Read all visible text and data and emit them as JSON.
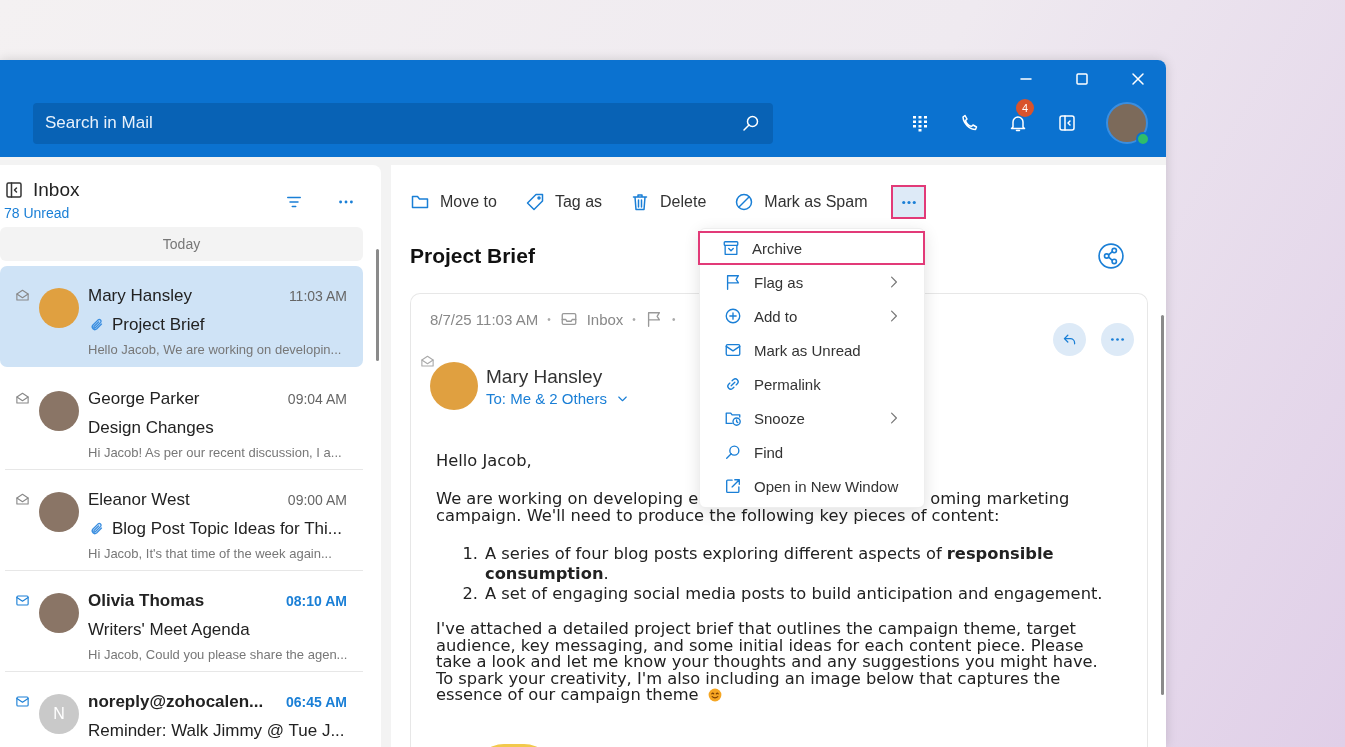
{
  "header": {
    "search": {
      "placeholder": "Search in Mail"
    },
    "notification_count": "4",
    "user": {
      "online": true
    }
  },
  "mail_list": {
    "title": "Inbox",
    "unread": "78 Unread",
    "group": "Today",
    "messages": [
      {
        "sender": "Mary Hansley",
        "time": "11:03 AM",
        "subject": "Project Brief",
        "preview": "Hello Jacob, We are working on developin...",
        "attachment": true,
        "unread": false,
        "selected": true
      },
      {
        "sender": "George Parker",
        "time": "09:04 AM",
        "subject": "Design Changes",
        "preview": "Hi Jacob! As per our recent discussion, I a...",
        "attachment": false,
        "unread": false,
        "selected": false
      },
      {
        "sender": "Eleanor West",
        "time": "09:00 AM",
        "subject": "Blog Post Topic Ideas for Thi...",
        "preview": "Hi Jacob, It's that time of the week again...",
        "attachment": true,
        "unread": false,
        "selected": false
      },
      {
        "sender": "Olivia Thomas",
        "time": "08:10 AM",
        "subject": "Writers' Meet Agenda",
        "preview": "Hi Jacob, Could you please share the agen...",
        "attachment": false,
        "unread": true,
        "selected": false
      },
      {
        "sender": "noreply@zohocalen...",
        "time": "06:45 AM",
        "subject": "Reminder: Walk Jimmy @ Tue J...",
        "attachment": false,
        "unread": true,
        "selected": false,
        "initial": "N"
      }
    ]
  },
  "toolbar": [
    {
      "kind": "folder",
      "label": "Move to"
    },
    {
      "kind": "tag",
      "label": "Tag as"
    },
    {
      "kind": "trash",
      "label": "Delete"
    },
    {
      "kind": "spam",
      "label": "Mark as Spam"
    }
  ],
  "more_menu": {
    "open": true,
    "items": [
      {
        "kind": "archive",
        "label": "Archive",
        "selected": true,
        "submenu": false
      },
      {
        "kind": "flag",
        "label": "Flag as",
        "selected": false,
        "submenu": true
      },
      {
        "kind": "add",
        "label": "Add to",
        "selected": false,
        "submenu": true
      },
      {
        "kind": "mail",
        "label": "Mark as Unread",
        "selected": false,
        "submenu": false
      },
      {
        "kind": "link",
        "label": "Permalink",
        "selected": false,
        "submenu": false
      },
      {
        "kind": "snooze",
        "label": "Snooze",
        "selected": false,
        "submenu": true
      },
      {
        "kind": "find",
        "label": "Find",
        "selected": false,
        "submenu": false
      },
      {
        "kind": "external",
        "label": "Open in New Window",
        "selected": false,
        "submenu": false
      }
    ]
  },
  "message": {
    "subject": "Project Brief",
    "date": "8/7/25 11:03 AM",
    "folder": "Inbox",
    "separators": [
      "•",
      "•",
      "•"
    ],
    "sender": "Mary Hansley",
    "recipients": "To: Me & 2 Others",
    "body": {
      "greeting": "Hello Jacob,",
      "line_1_start": "We are working on developing e",
      "line_1_end": "oming marketing",
      "line_2": "campaign. We'll need to produce the following key pieces of content:",
      "list": [
        {
          "number": "1.",
          "text": "A series of four blog posts exploring different aspects of **responsible consumption**."
        },
        {
          "number": "2.",
          "text": "A set of engaging social media posts to build anticipation and engagement."
        }
      ],
      "closing": "I've attached a detailed project brief that outlines the campaign theme, target audience, key messaging, and some initial ideas for each content piece. Please take a look and let me know your thoughts and any suggestions you might have. To spark your creativity, I'm also including an image below that captures the",
      "closing_end": "essence of our campaign theme"
    }
  }
}
